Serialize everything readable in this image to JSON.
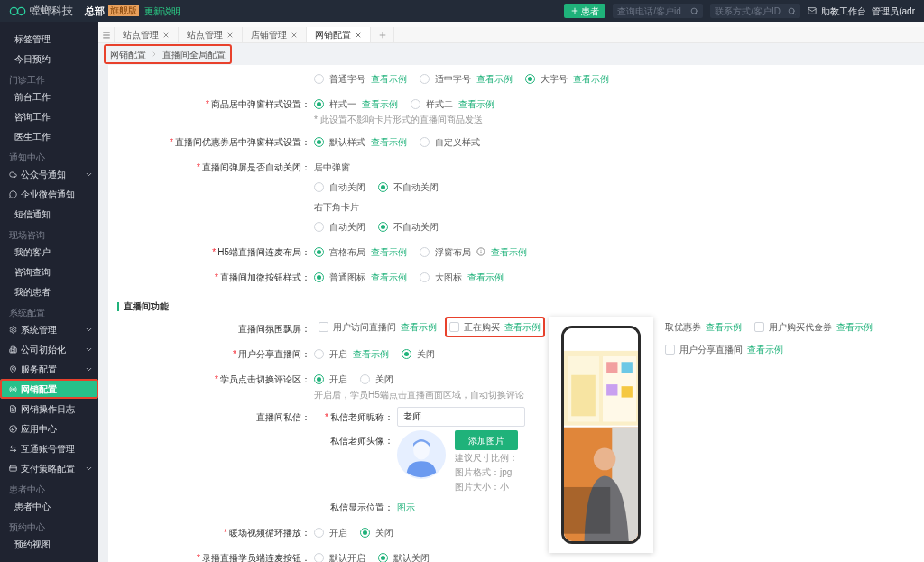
{
  "header": {
    "logo": "螳螂科技",
    "org": "总部",
    "edition_badge": "旗舰版",
    "update_link": "更新说明",
    "add_button": "患者",
    "search_fields": [
      {
        "placeholder": "查询电话/客户id"
      },
      {
        "placeholder": "联系方式/客户ID"
      }
    ],
    "workbench_link": "助教工作台",
    "user": "管理员(adr"
  },
  "sidebar": {
    "sections": [
      {
        "items": [
          {
            "label": "标签管理",
            "selected": false
          },
          {
            "label": "今日预约",
            "selected": false
          }
        ]
      },
      {
        "header": "门诊工作",
        "items": [
          {
            "label": "前台工作",
            "selected": false
          },
          {
            "label": "咨询工作",
            "selected": false
          },
          {
            "label": "医生工作",
            "selected": false
          }
        ]
      },
      {
        "header": "通知中心",
        "items": [
          {
            "label": "公众号通知",
            "icon": true,
            "expanded": false,
            "selected": false
          },
          {
            "label": "企业微信通知",
            "icon": true,
            "selected": false
          },
          {
            "label": "短信通知",
            "selected": false
          }
        ]
      },
      {
        "header": "现场咨询",
        "items": [
          {
            "label": "我的客户",
            "selected": false
          },
          {
            "label": "咨询查询",
            "selected": false
          },
          {
            "label": "我的患者",
            "selected": false
          }
        ]
      },
      {
        "header": "系统配置",
        "items": [
          {
            "label": "系统管理",
            "icon": true,
            "expanded": false,
            "selected": false
          },
          {
            "label": "公司初始化",
            "icon": true,
            "expanded": false,
            "selected": false
          },
          {
            "label": "服务配置",
            "icon": true,
            "expanded": false,
            "selected": false
          },
          {
            "label": "网销配置",
            "icon": true,
            "selected": true,
            "highlighted": true
          },
          {
            "label": "网销操作日志",
            "icon": true,
            "selected": false
          },
          {
            "label": "应用中心",
            "icon": true,
            "selected": false
          },
          {
            "label": "互通账号管理",
            "icon": true,
            "selected": false
          },
          {
            "label": "支付策略配置",
            "icon": true,
            "expanded": false,
            "selected": false
          }
        ]
      },
      {
        "header": "患者中心",
        "items": [
          {
            "label": "患者中心",
            "selected": false
          }
        ]
      },
      {
        "header": "预约中心",
        "items": [
          {
            "label": "预约视图",
            "selected": false
          }
        ]
      }
    ]
  },
  "tabs": [
    {
      "label": "站点管理",
      "selected": false
    },
    {
      "label": "站点管理",
      "selected": false
    },
    {
      "label": "店铺管理",
      "selected": false
    },
    {
      "label": "网销配置",
      "selected": true
    }
  ],
  "breadcrumb": {
    "items": [
      "网销配置",
      "直播间全局配置"
    ],
    "highlighted": true
  },
  "form_rows": [
    {
      "kind": "radio",
      "options": [
        {
          "label": "普通字号",
          "selected": false,
          "link": "查看示例"
        },
        {
          "label": "适中字号",
          "selected": false,
          "link": "查看示例"
        },
        {
          "label": "大字号",
          "selected": true,
          "link": "查看示例"
        }
      ]
    },
    {
      "kind": "radio",
      "label": "商品居中弹窗样式设置：",
      "required_mark": "*",
      "options": [
        {
          "label": "样式一",
          "selected": true,
          "link": "查看示例"
        },
        {
          "label": "样式二",
          "selected": false,
          "link": "查看示例"
        }
      ],
      "note": "* 此设置不影响卡片形式的直播间商品发送"
    },
    {
      "kind": "radio",
      "label": "直播间优惠券居中弹窗样式设置：",
      "required_mark": "*",
      "options": [
        {
          "label": "默认样式",
          "selected": true,
          "link": "查看示例"
        },
        {
          "label": "自定义样式",
          "selected": false
        }
      ]
    },
    {
      "kind": "radio_groups",
      "label": "直播间弹屏是否自动关闭：",
      "required_mark": "*",
      "groups": [
        {
          "title": "居中弹窗",
          "options": [
            {
              "label": "自动关闭",
              "selected": false
            },
            {
              "label": "不自动关闭",
              "selected": true
            }
          ]
        },
        {
          "title": "右下角卡片",
          "options": [
            {
              "label": "自动关闭",
              "selected": false
            },
            {
              "label": "不自动关闭",
              "selected": true
            }
          ]
        }
      ]
    },
    {
      "kind": "radio",
      "label": "H5端直播间连麦布局：",
      "required_mark": "*",
      "options": [
        {
          "label": "宫格布局",
          "selected": true,
          "link": "查看示例"
        },
        {
          "label": "浮窗布局",
          "selected": false,
          "info": true,
          "link": "查看示例"
        }
      ]
    },
    {
      "kind": "radio",
      "label": "直播间加微按钮样式：",
      "required_mark": "*",
      "options": [
        {
          "label": "普通图标",
          "selected": true,
          "link": "查看示例"
        },
        {
          "label": "大图标",
          "selected": false,
          "link": "查看示例"
        }
      ]
    }
  ],
  "live_features": {
    "title": "直播间功能",
    "rows": [
      {
        "kind": "checkbox",
        "label": "直播间氛围飘屏：",
        "options": [
          {
            "label": "用户访问直播间",
            "checked": false,
            "link": "查看示例",
            "highlighted": false
          },
          {
            "label": "正在购买",
            "checked": false,
            "link": "查看示例",
            "highlighted": true
          },
          {
            "label": "取优惠券",
            "link": "查看示例",
            "highlighted": false
          },
          {
            "label": "用户购买代金券",
            "checked": false,
            "link": "查看示例",
            "highlighted": false
          },
          {
            "label": "用户分享直播间",
            "checked": false,
            "link": "查看示例",
            "highlighted": false
          }
        ]
      },
      {
        "kind": "radio",
        "label": "用户分享直播间：",
        "required_mark": "*",
        "options": [
          {
            "label": "开启",
            "selected": false,
            "link": "查看示例"
          },
          {
            "label": "关闭",
            "selected": true
          }
        ]
      },
      {
        "kind": "radio",
        "label": "学员点击切换评论区：",
        "required_mark": "*",
        "options": [
          {
            "label": "开启",
            "selected": true
          },
          {
            "label": "关闭",
            "selected": false
          }
        ],
        "note": "开启后，学员H5端点击直播画面区域，自动切换评论"
      },
      {
        "kind": "private_message",
        "label": "直播间私信：",
        "nickname": {
          "label": "私信老师昵称：",
          "required_mark": "*",
          "value": "老师"
        },
        "avatar": {
          "label": "私信老师头像：",
          "button": "添加图片",
          "hints": [
            "建议尺寸比例：",
            "图片格式：jpg",
            "图片大小：小"
          ]
        },
        "position": {
          "label": "私信显示位置：",
          "link": "图示"
        }
      },
      {
        "kind": "radio",
        "label": "暖场视频循环播放：",
        "required_mark": "*",
        "options": [
          {
            "label": "开启",
            "selected": false
          },
          {
            "label": "关闭",
            "selected": true
          }
        ]
      },
      {
        "kind": "radio",
        "label": "录播直播学员端连麦按钮：",
        "required_mark": "*",
        "options": [
          {
            "label": "默认开启",
            "selected": false
          },
          {
            "label": "默认关闭",
            "selected": true
          }
        ]
      }
    ]
  }
}
